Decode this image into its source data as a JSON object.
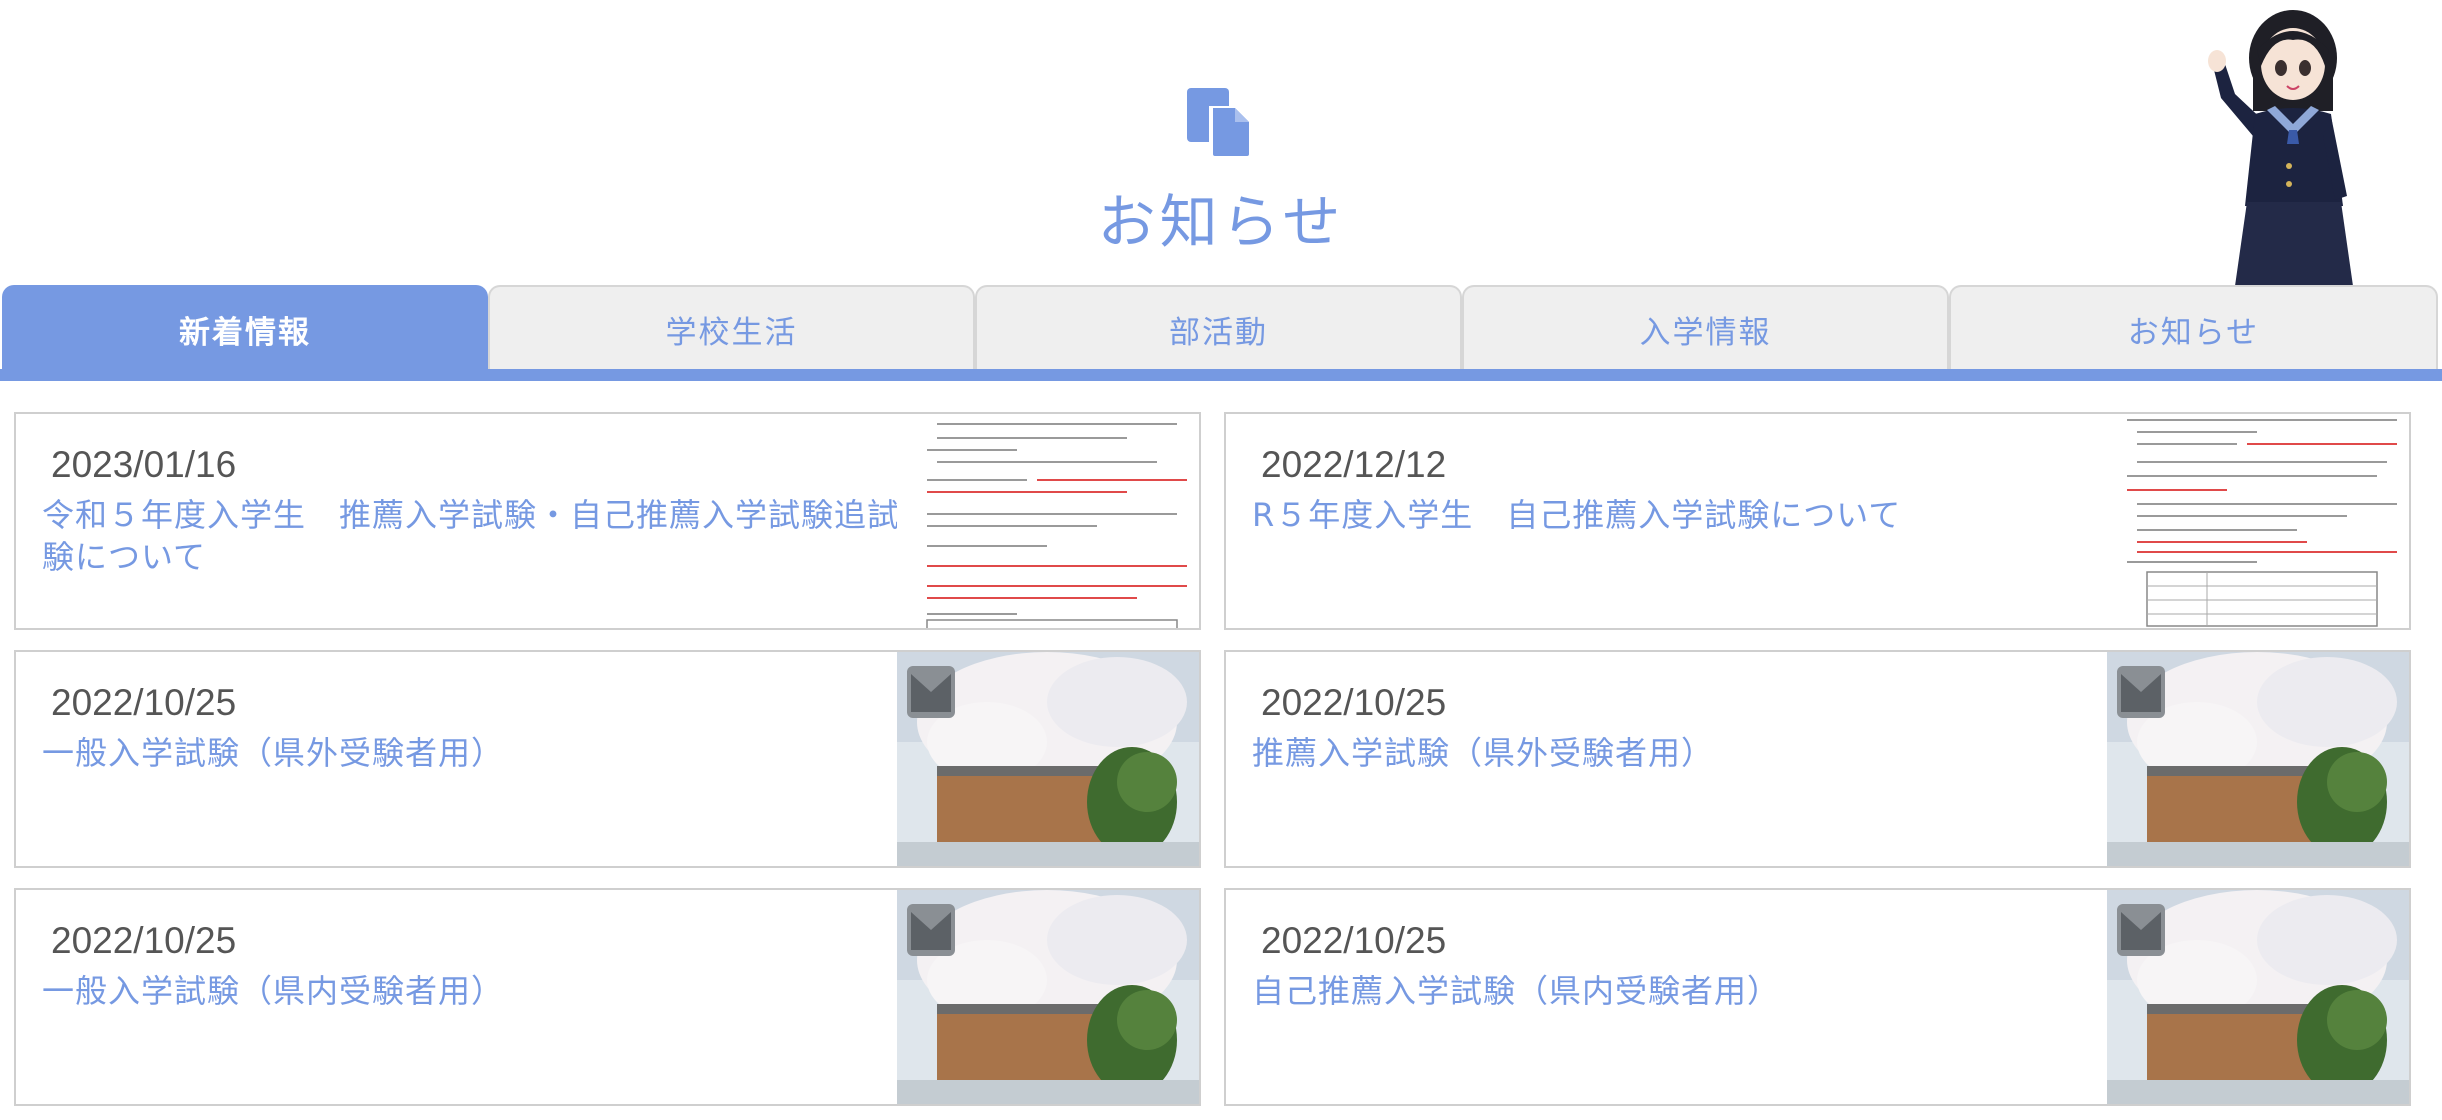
{
  "header": {
    "title": "お知らせ",
    "icon": "document-icon"
  },
  "mascot": {
    "icon": "schoolgirl-mascot"
  },
  "tabs": [
    {
      "label": "新着情報",
      "active": true
    },
    {
      "label": "学校生活",
      "active": false
    },
    {
      "label": "部活動",
      "active": false
    },
    {
      "label": "入学情報",
      "active": false
    },
    {
      "label": "お知らせ",
      "active": false
    }
  ],
  "news": [
    {
      "date": "2023/01/16",
      "title": "令和５年度入学生　推薦入学試験・自己推薦入学試験追試験について",
      "thumb": "document-scan-thumbnail"
    },
    {
      "date": "2022/12/12",
      "title": "R５年度入学生　自己推薦入学試験について",
      "thumb": "document-scan-thumbnail"
    },
    {
      "date": "2022/10/25",
      "title": "一般入学試験（県外受験者用）",
      "thumb": "school-cherry-blossom-photo"
    },
    {
      "date": "2022/10/25",
      "title": "推薦入学試験（県外受験者用）",
      "thumb": "school-cherry-blossom-photo"
    },
    {
      "date": "2022/10/25",
      "title": "一般入学試験（県内受験者用）",
      "thumb": "school-cherry-blossom-photo"
    },
    {
      "date": "2022/10/25",
      "title": "自己推薦入学試験（県内受験者用）",
      "thumb": "school-cherry-blossom-photo"
    }
  ],
  "colors": {
    "accent": "#7699e2",
    "tab_inactive": "#efefef",
    "date_text": "#555555",
    "card_border": "#cfcfcf"
  }
}
